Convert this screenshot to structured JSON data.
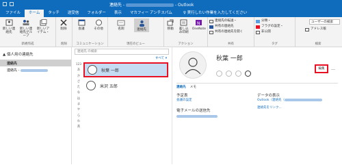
{
  "window": {
    "title": "連絡先 - ",
    "title_suffix": " - Outlook"
  },
  "tabs": [
    "ファイル",
    "ホーム",
    "タッチ",
    "送受信",
    "フォルダー",
    "表示",
    "マカフィー アンチスパム"
  ],
  "tellme": "♀ 実行したい作業を入力してください",
  "ribbon": {
    "new": {
      "b1": "新しい連絡先",
      "b2": "新しい連絡先グループ",
      "b3": "新しいアイテム・",
      "group": "新規作成"
    },
    "delete": {
      "b1": "削除",
      "group": "削除"
    },
    "comm": {
      "b1": "会議",
      "b2": "その他",
      "group": "コミュニケーション"
    },
    "view": {
      "b1": "名刺",
      "b2": "連絡先",
      "group": "現在のビュー"
    },
    "actions": {
      "b1": "移動",
      "b2": "差し込み印刷",
      "b3": "OneNote",
      "group": "アクション"
    },
    "share": {
      "s1": "連絡先の転送・",
      "s2": "共有の連絡先",
      "s3": "共有の連絡先を開く",
      "group": "共有"
    },
    "tags": {
      "s1": "分類・",
      "s2": "フラグの設定・",
      "s3": "非公開",
      "group": "タグ"
    },
    "find": {
      "placeholder": "ユーザーの検索",
      "s2": "アドレス帳",
      "group": "検索"
    }
  },
  "nav": {
    "header": "▲ 個人用の連絡先",
    "items": [
      "連絡先",
      "連絡先 -"
    ]
  },
  "list": {
    "search_placeholder": "連絡先 の検索",
    "all": "すべて ▾",
    "letters": [
      "123",
      "あ",
      "か",
      "さ",
      "た",
      "な",
      "は",
      "ま",
      "や",
      "ら",
      "わ",
      "英"
    ],
    "contacts": [
      "秋葉 一郎",
      "米沢 五郎"
    ]
  },
  "detail": {
    "name": "秋葉 一郎",
    "edit": "編集",
    "more": "…",
    "tab_contact": "連絡先",
    "tab_memo": "メモ",
    "schedule_label": "予定表",
    "schedule_link": "会議の設定",
    "email_label": "電子メールの送信先",
    "data_label": "データの表示",
    "data_value": "Outlook（連絡先（",
    "data_link": "連絡先をリンク..."
  }
}
